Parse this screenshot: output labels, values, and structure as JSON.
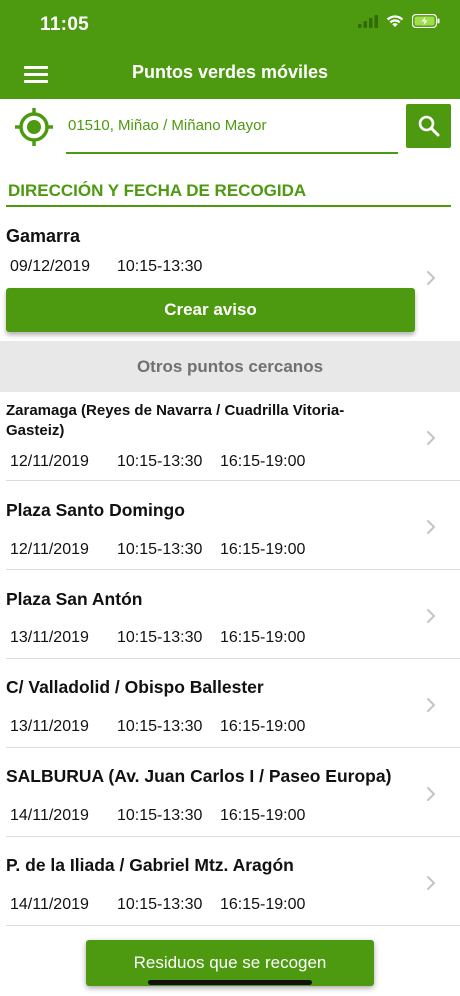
{
  "status_bar": {
    "time": "11:05"
  },
  "header": {
    "title": "Puntos verdes móviles"
  },
  "search": {
    "location": "01510, Miñao / Miñano Mayor"
  },
  "section": {
    "title": "DIRECCIÓN Y FECHA DE RECOGIDA"
  },
  "main_point": {
    "name": "Gamarra",
    "date": "09/12/2019",
    "time": "10:15-13:30"
  },
  "create_button": "Crear aviso",
  "nearby_header": "Otros puntos cercanos",
  "nearby": [
    {
      "name": "Zaramaga (Reyes de Navarra / Cuadrilla Vitoria-Gasteiz)",
      "date": "12/11/2019",
      "time1": "10:15-13:30",
      "time2": "16:15-19:00"
    },
    {
      "name": "Plaza Santo Domingo",
      "date": "12/11/2019",
      "time1": "10:15-13:30",
      "time2": "16:15-19:00"
    },
    {
      "name": "Plaza San Antón",
      "date": "13/11/2019",
      "time1": "10:15-13:30",
      "time2": "16:15-19:00"
    },
    {
      "name": "C/ Valladolid / Obispo Ballester",
      "date": "13/11/2019",
      "time1": "10:15-13:30",
      "time2": "16:15-19:00"
    },
    {
      "name": "SALBURUA (Av. Juan Carlos I / Paseo Europa)",
      "date": "14/11/2019",
      "time1": "10:15-13:30",
      "time2": "16:15-19:00"
    },
    {
      "name": "P. de la Iliada / Gabriel Mtz. Aragón",
      "date": "14/11/2019",
      "time1": "10:15-13:30",
      "time2": "16:15-19:00"
    }
  ],
  "bottom_button": "Residuos que se recogen",
  "icons": {
    "menu": "menu-icon",
    "locate": "locate-icon",
    "search": "search-icon",
    "chevron": "chevron-right-icon",
    "wifi": "wifi-icon",
    "battery": "battery-charging-icon",
    "signal": "signal-icon"
  },
  "colors": {
    "primary": "#4d9a10",
    "grey_header": "#e8e8e8"
  }
}
